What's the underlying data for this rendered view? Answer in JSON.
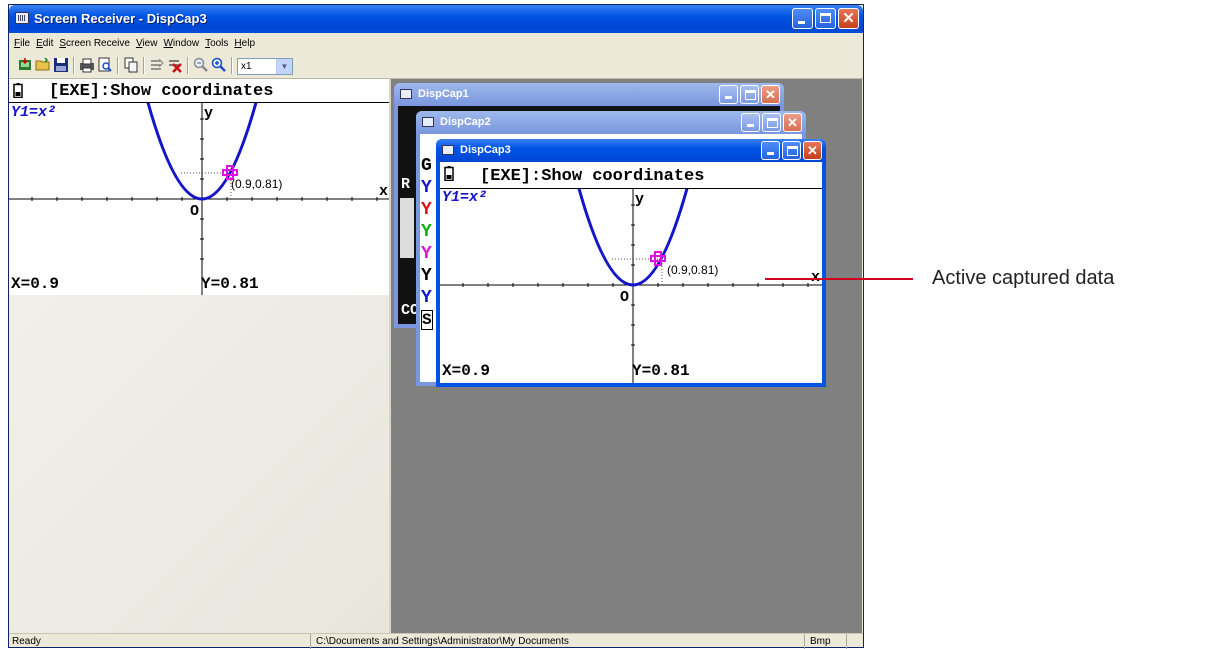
{
  "window": {
    "title": "Screen Receiver - DispCap3",
    "menu": [
      "File",
      "Edit",
      "Screen Receive",
      "View",
      "Window",
      "Tools",
      "Help"
    ],
    "toolbar": {
      "zoom_value": "x1",
      "icons": [
        "receive-icon",
        "open-icon",
        "save-icon",
        "print-icon",
        "print-preview-icon",
        "copy-icon",
        "copy-select-icon",
        "delete-icon",
        "zoom-out-icon",
        "zoom-in-icon"
      ]
    }
  },
  "calc_main": {
    "header": "[EXE]:Show coordinates",
    "func": "Y1=x²",
    "axis_y": "y",
    "axis_x": "x",
    "origin": "O",
    "point": "(0.9,0.81)",
    "xval": "X=0.9",
    "yval": "Y=0.81"
  },
  "children": [
    {
      "title": "DispCap1",
      "partial_lines": [
        "R",
        "CO"
      ]
    },
    {
      "title": "DispCap2",
      "partial_lines": [
        "G",
        "Y",
        "Y",
        "Y",
        "Y",
        "Y",
        "Y",
        "S"
      ]
    },
    {
      "title": "DispCap3",
      "header": "[EXE]:Show coordinates",
      "func": "Y1=x²",
      "axis_y": "y",
      "axis_x": "x",
      "origin": "O",
      "point": "(0.9,0.81)",
      "xval": "X=0.9",
      "yval": "Y=0.81"
    }
  ],
  "status": {
    "ready": "Ready",
    "path": "C:\\Documents and Settings\\Administrator\\My Documents",
    "format": "Bmp"
  },
  "annotation": "Active captured data",
  "colors": {
    "curve": "#1414c8",
    "cursor": "#e010e0",
    "annotation_line": "#d0001f",
    "mdi_client": "#808080"
  }
}
